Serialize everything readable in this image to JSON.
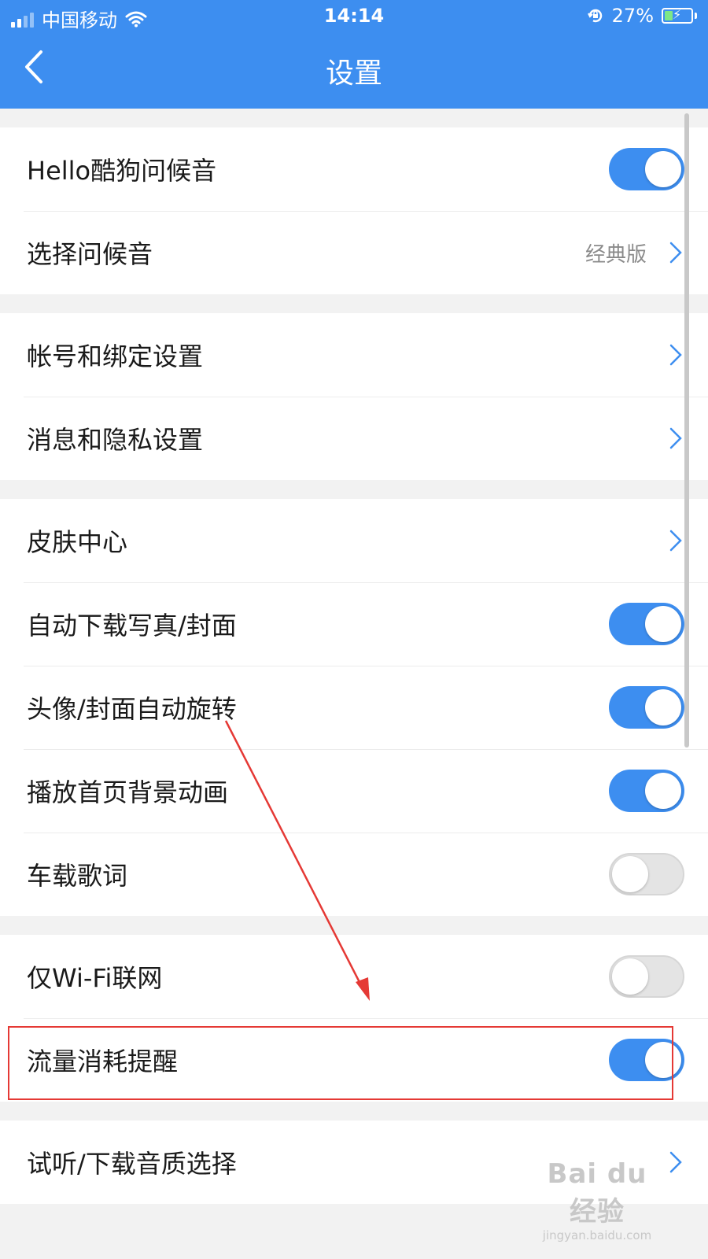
{
  "status_bar": {
    "carrier": "中国移动",
    "time": "14:14",
    "battery": "27%",
    "battery_level": 0.27,
    "icons": [
      "signal-icon",
      "wifi-icon",
      "rotation-lock-icon",
      "battery-charging-icon"
    ]
  },
  "header": {
    "title": "设置",
    "back_icon": "chevron-left-icon"
  },
  "colors": {
    "accent": "#3d8ef0",
    "toggle_off": "#e4e4e4",
    "annotation": "#e53935"
  },
  "sections": [
    {
      "rows": [
        {
          "label": "Hello酷狗问候音",
          "control": "toggle",
          "on": true
        },
        {
          "label": "选择问候音",
          "control": "chevron",
          "value": "经典版"
        }
      ]
    },
    {
      "rows": [
        {
          "label": "帐号和绑定设置",
          "control": "chevron"
        },
        {
          "label": "消息和隐私设置",
          "control": "chevron"
        }
      ]
    },
    {
      "rows": [
        {
          "label": "皮肤中心",
          "control": "chevron"
        },
        {
          "label": "自动下载写真/封面",
          "control": "toggle",
          "on": true
        },
        {
          "label": "头像/封面自动旋转",
          "control": "toggle",
          "on": true
        },
        {
          "label": "播放首页背景动画",
          "control": "toggle",
          "on": true
        },
        {
          "label": "车载歌词",
          "control": "toggle",
          "on": false
        }
      ]
    },
    {
      "rows": [
        {
          "label": "仅Wi-Fi联网",
          "control": "toggle",
          "on": false
        },
        {
          "label": "流量消耗提醒",
          "control": "toggle",
          "on": true
        }
      ]
    },
    {
      "rows": [
        {
          "label": "试听/下载音质选择",
          "control": "chevron"
        }
      ]
    }
  ],
  "watermark": {
    "logo": "Bai du 经验",
    "url": "jingyan.baidu.com"
  }
}
